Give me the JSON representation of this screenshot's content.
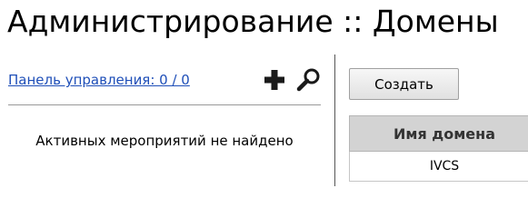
{
  "page": {
    "title": "Администрирование :: Домены"
  },
  "left_panel": {
    "link_label": "Панель управления: 0 / 0",
    "icons": {
      "add": "plus-icon",
      "search": "magnifier-icon"
    },
    "empty_message": "Активных мероприятий не найдено"
  },
  "right_panel": {
    "create_button": "Создать",
    "table": {
      "header": "Имя домена",
      "rows": [
        {
          "name": "IVCS"
        }
      ]
    }
  }
}
